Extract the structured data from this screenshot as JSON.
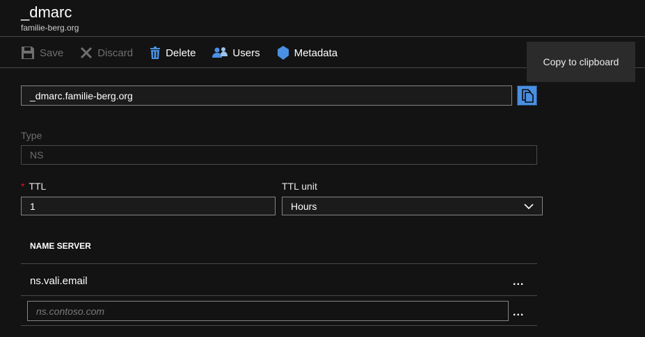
{
  "header": {
    "title": "_dmarc",
    "subtitle": "familie-berg.org"
  },
  "toolbar": {
    "save_label": "Save",
    "discard_label": "Discard",
    "delete_label": "Delete",
    "users_label": "Users",
    "metadata_label": "Metadata",
    "icons": {
      "save": "save-icon",
      "discard": "discard-icon",
      "delete": "trash-icon",
      "users": "users-icon",
      "metadata": "tag-icon"
    }
  },
  "tooltip": {
    "text": "Copy to clipboard"
  },
  "name_field": {
    "value": "_dmarc.familie-berg.org",
    "copy_icon": "copy-icon"
  },
  "type": {
    "label": "Type",
    "value": "NS"
  },
  "ttl": {
    "required_mark": "*",
    "label": "TTL",
    "value": "1"
  },
  "ttl_unit": {
    "label": "TTL unit",
    "value": "Hours"
  },
  "name_servers": {
    "column_header": "NAME SERVER",
    "rows": [
      {
        "value": "ns.vali.email",
        "menu": "..."
      }
    ],
    "new_row": {
      "placeholder": "ns.contoso.com",
      "menu": "..."
    }
  },
  "colors": {
    "accent": "#4a90e2",
    "required": "#e81123",
    "background": "#131313"
  }
}
